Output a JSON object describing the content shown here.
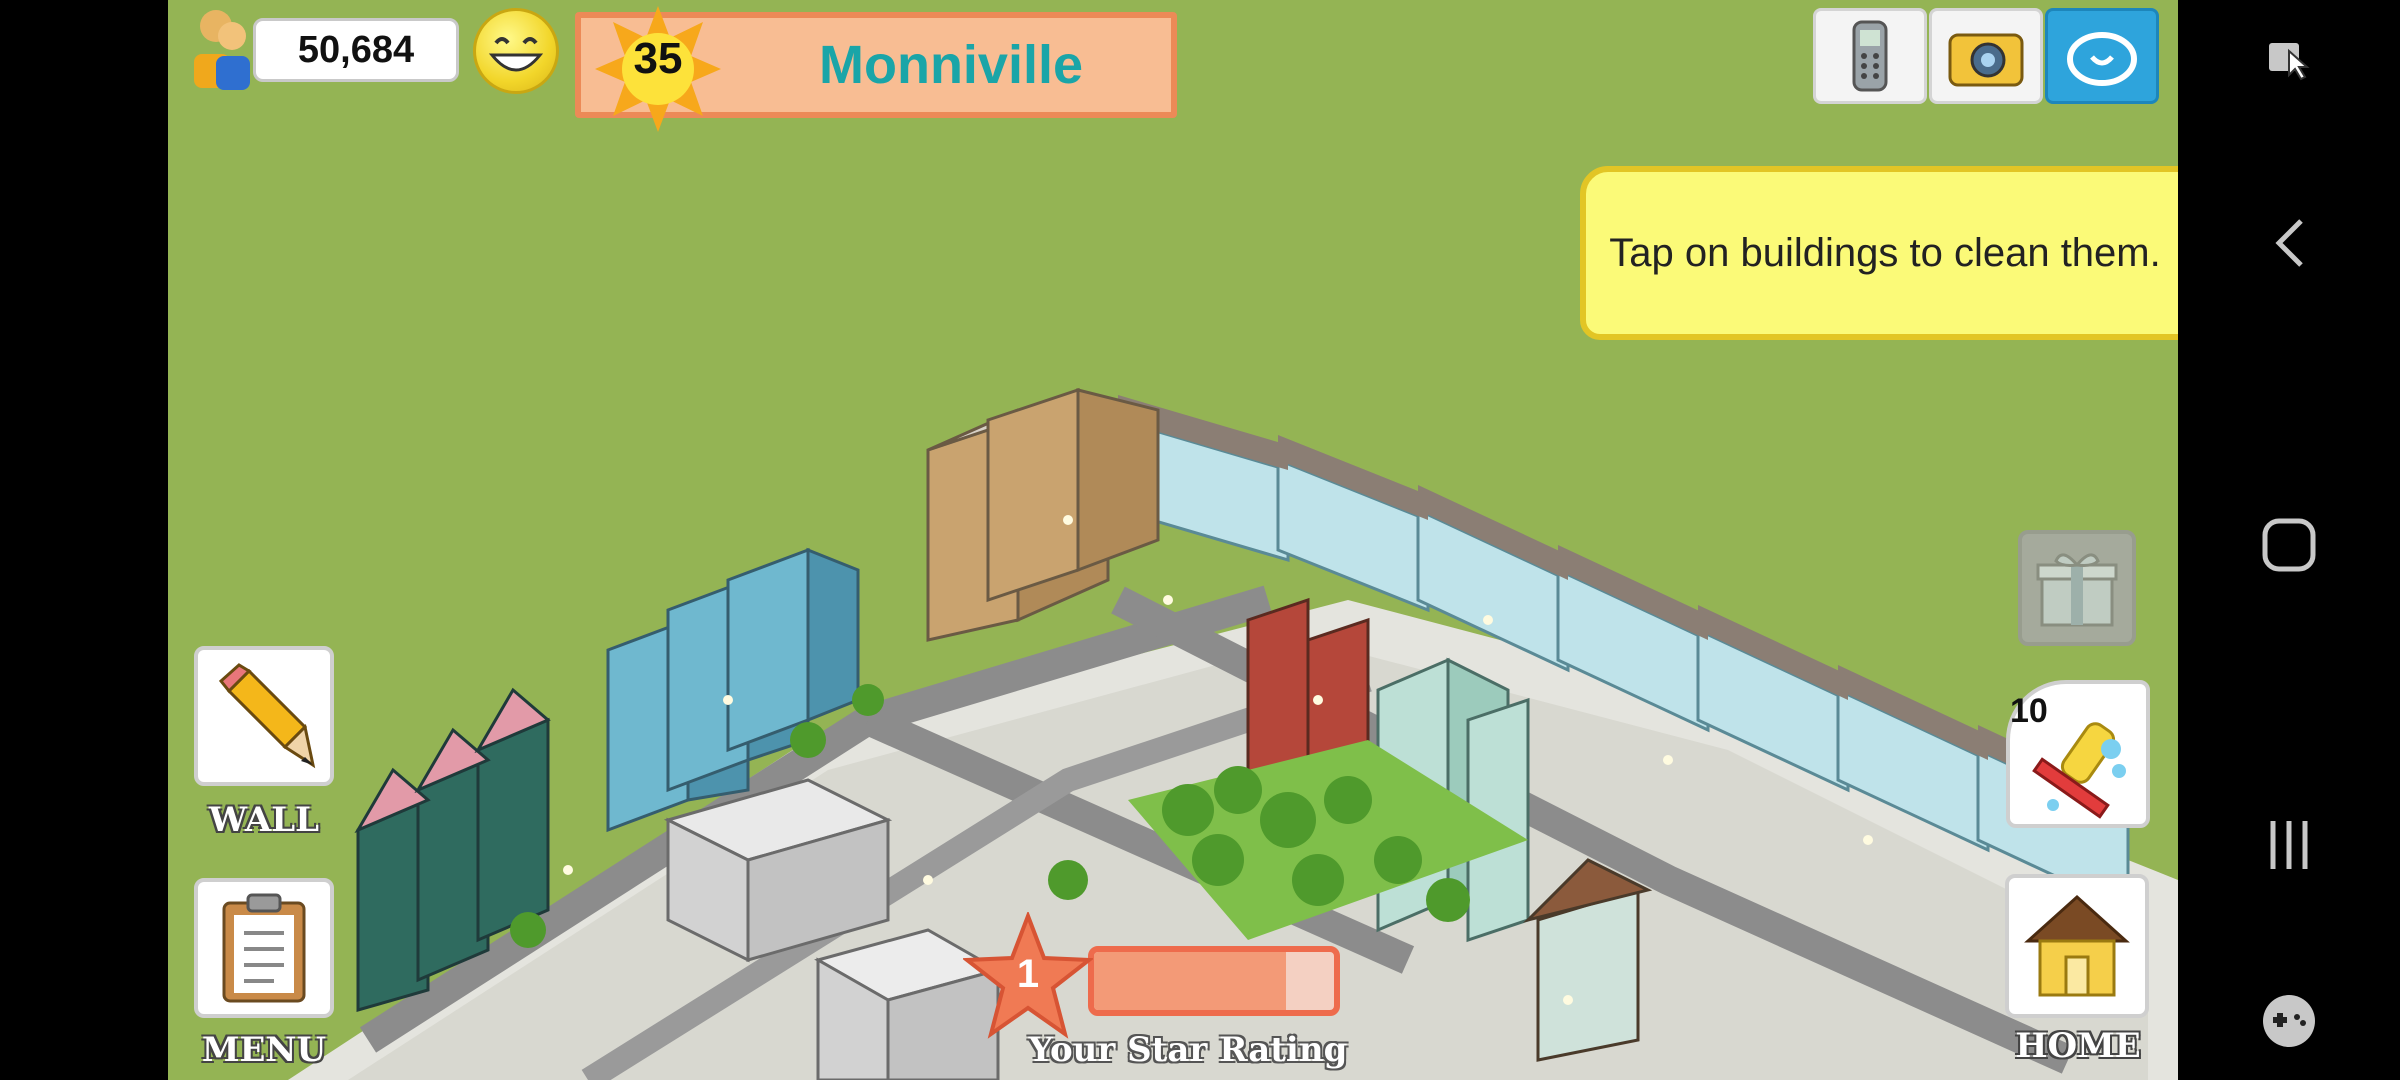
{
  "hud": {
    "population": "50,684",
    "level": "35",
    "city_name": "Monniville"
  },
  "top_buttons": [
    {
      "name": "phone-icon"
    },
    {
      "name": "camera-icon"
    },
    {
      "name": "share-icon"
    }
  ],
  "tooltip": {
    "text": "Tap on buildings to clean them."
  },
  "left_buttons": {
    "wall_label": "WALL",
    "menu_label": "MENU"
  },
  "right_buttons": {
    "clean_count": "10",
    "home_label": "HOME"
  },
  "star_rating": {
    "value": "1",
    "label": "Your Star Rating",
    "progress": 0.8
  },
  "colors": {
    "grass": "#94b454",
    "city_name": "#1aa5a8",
    "tooltip_bg": "#fbfa78",
    "star": "#ee6b4c"
  },
  "system_nav": [
    "screenshot-icon",
    "back-icon",
    "home-nav-icon",
    "recents-icon",
    "game-tools-icon"
  ]
}
